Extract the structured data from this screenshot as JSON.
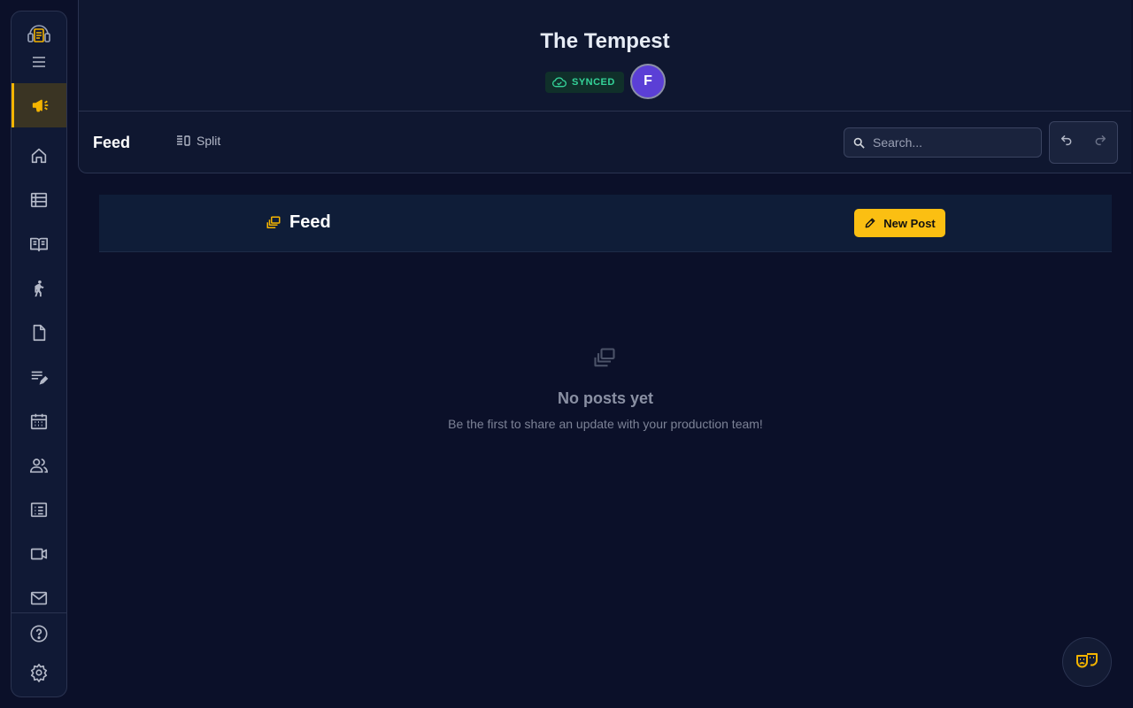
{
  "project": {
    "title": "The Tempest",
    "sync_status": "SYNCED",
    "user_initial": "F"
  },
  "toolbar": {
    "view_title": "Feed",
    "split_label": "Split",
    "search_placeholder": "Search..."
  },
  "feed": {
    "title": "Feed",
    "new_post_label": "New Post",
    "empty_title": "No posts yet",
    "empty_subtitle": "Be the first to share an update with your production team!"
  },
  "sidebar": {
    "active_item": "announcements-icon",
    "items": [
      "home-icon",
      "table-icon",
      "book-icon",
      "walking-person-icon",
      "document-icon",
      "edit-list-icon",
      "calendar-icon",
      "people-icon",
      "list-icon",
      "video-icon",
      "mail-icon"
    ],
    "bottom_items": [
      "help-icon",
      "settings-icon"
    ]
  },
  "colors": {
    "accent": "#fbbf12",
    "synced": "#34d399",
    "avatar": "#5b3fd6",
    "background": "#0b1029"
  }
}
